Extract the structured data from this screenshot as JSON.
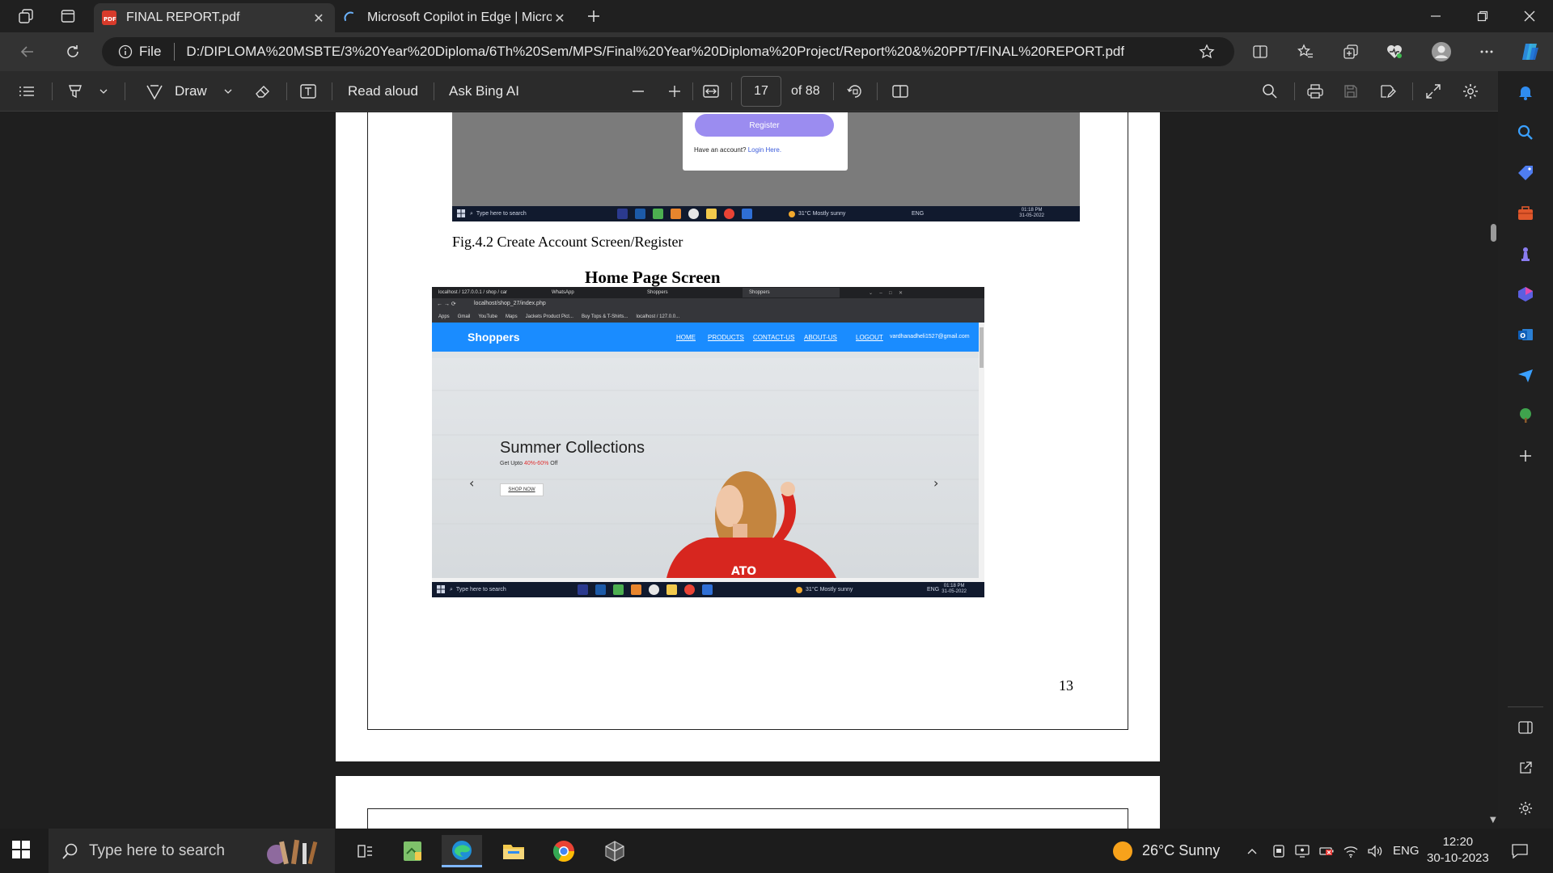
{
  "browser": {
    "tabs": [
      {
        "title": "FINAL REPORT.pdf",
        "active": true
      },
      {
        "title": "Microsoft Copilot in Edge | Microsoft",
        "active": false
      }
    ],
    "address": {
      "file_label": "File",
      "url": "D:/DIPLOMA%20MSBTE/3%20Year%20Diploma/6Th%20Sem/MPS/Final%20Year%20Diploma%20Project/Report%20&%20PPT/FINAL%20REPORT.pdf"
    }
  },
  "pdf_toolbar": {
    "draw_label": "Draw",
    "read_aloud_label": "Read aloud",
    "ask_bing_label": "Ask Bing AI",
    "current_page": "17",
    "page_total_label": "of 88"
  },
  "document": {
    "fig1": {
      "register_button": "Register",
      "have_account": "Have an account?",
      "login_link": "Login Here.",
      "caption": "Fig.4.2 Create Account Screen/Register",
      "mini_taskbar": {
        "search": "Type here to search",
        "weather": "31°C  Mostly sunny",
        "lang": "ENG",
        "time": "01:18 PM",
        "date": "31-05-2022"
      }
    },
    "section_heading": "Home Page Screen",
    "fig2": {
      "chrome_tabs": [
        "localhost / 127.0.0.1 / shop / car",
        "WhatsApp",
        "Shoppers",
        "Shoppers"
      ],
      "omnibox_url": "localhost/shop_27/index.php",
      "bookmarks": [
        "Apps",
        "Gmail",
        "YouTube",
        "Maps",
        "Jackets Product Pict...",
        "Buy Tops & T-Shirts...",
        "localhost / 127.0.0..."
      ],
      "brand": "Shoppers",
      "nav_links": [
        "HOME",
        "PRODUCTS",
        "CONTACT-US",
        "ABOUT-US",
        "LOGOUT"
      ],
      "user_email": "vardhanadheli1527@gmail.com",
      "hero_title": "Summer Collections",
      "hero_sub_prefix": "Get Upto",
      "hero_sub_highlight": "40%-60%",
      "hero_sub_suffix": "Off",
      "shop_button": "SHOP NOW",
      "prev_arrow": "‹",
      "next_arrow": "›",
      "mini_taskbar": {
        "search": "Type here to search",
        "weather": "31°C  Mostly sunny",
        "lang": "ENG",
        "time": "01:18 PM",
        "date": "31-05-2022"
      }
    },
    "page_number": "13"
  },
  "taskbar": {
    "search_placeholder": "Type here to search",
    "weather": "26°C  Sunny",
    "language": "ENG",
    "time": "12:20",
    "date": "30-10-2023"
  },
  "colors": {
    "accent_blue": "#1a8cff",
    "register_purple": "#9b8cf0",
    "highlight_red": "#e03131"
  }
}
